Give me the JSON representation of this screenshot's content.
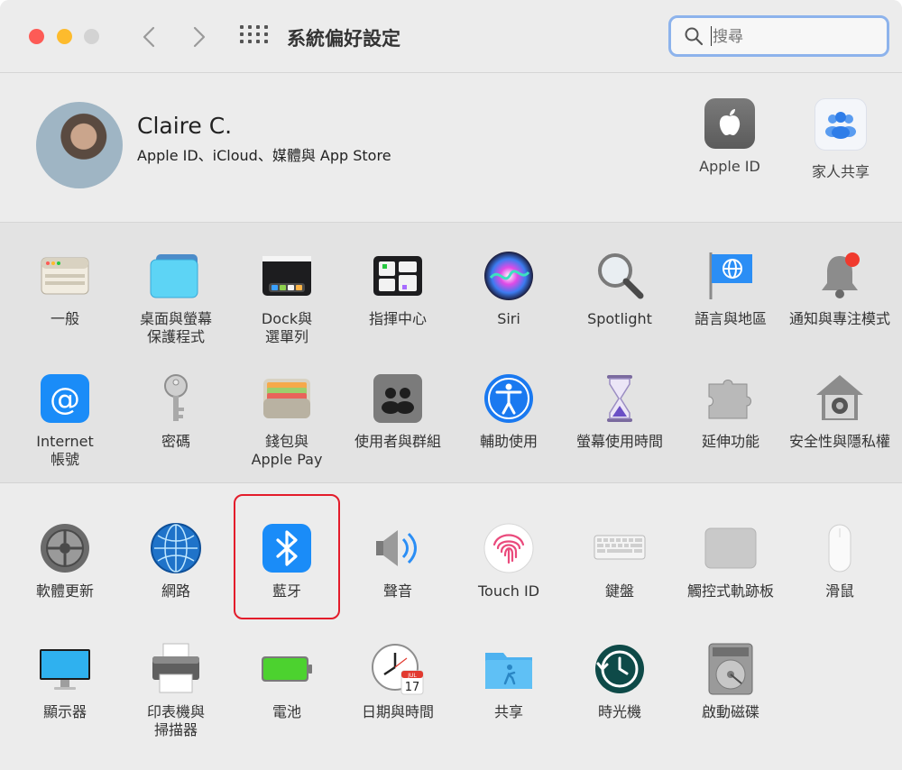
{
  "window": {
    "title": "系統偏好設定"
  },
  "search": {
    "placeholder": "搜尋",
    "value": ""
  },
  "account": {
    "name": "Claire C.",
    "subtitle": "Apple ID、iCloud、媒體與 App Store",
    "items": [
      {
        "label": "Apple ID",
        "icon": "apple-logo-icon"
      },
      {
        "label": "家人共享",
        "icon": "family-sharing-icon"
      }
    ]
  },
  "panes_row1": [
    {
      "label": "一般",
      "icon": "general-icon"
    },
    {
      "label": "桌面與螢幕\n保護程式",
      "icon": "desktop-screensaver-icon"
    },
    {
      "label": "Dock與\n選單列",
      "icon": "dock-menubar-icon"
    },
    {
      "label": "指揮中心",
      "icon": "mission-control-icon"
    },
    {
      "label": "Siri",
      "icon": "siri-icon"
    },
    {
      "label": "Spotlight",
      "icon": "spotlight-icon"
    },
    {
      "label": "語言與地區",
      "icon": "language-region-icon"
    },
    {
      "label": "通知與專注模式",
      "icon": "notifications-icon"
    }
  ],
  "panes_row2": [
    {
      "label": "Internet\n帳號",
      "icon": "internet-accounts-icon"
    },
    {
      "label": "密碼",
      "icon": "passwords-key-icon"
    },
    {
      "label": "錢包與\nApple Pay",
      "icon": "wallet-icon"
    },
    {
      "label": "使用者與群組",
      "icon": "users-groups-icon"
    },
    {
      "label": "輔助使用",
      "icon": "accessibility-icon"
    },
    {
      "label": "螢幕使用時間",
      "icon": "screen-time-icon"
    },
    {
      "label": "延伸功能",
      "icon": "extensions-icon"
    },
    {
      "label": "安全性與隱私權",
      "icon": "security-privacy-icon"
    }
  ],
  "panes_row3": [
    {
      "label": "軟體更新",
      "icon": "software-update-icon"
    },
    {
      "label": "網路",
      "icon": "network-icon"
    },
    {
      "label": "藍牙",
      "icon": "bluetooth-icon"
    },
    {
      "label": "聲音",
      "icon": "sound-icon"
    },
    {
      "label": "Touch ID",
      "icon": "touch-id-icon"
    },
    {
      "label": "鍵盤",
      "icon": "keyboard-icon"
    },
    {
      "label": "觸控式軌跡板",
      "icon": "trackpad-icon"
    },
    {
      "label": "滑鼠",
      "icon": "mouse-icon"
    }
  ],
  "panes_row4": [
    {
      "label": "顯示器",
      "icon": "displays-icon"
    },
    {
      "label": "印表機與\n掃描器",
      "icon": "printers-scanners-icon"
    },
    {
      "label": "電池",
      "icon": "battery-icon"
    },
    {
      "label": "日期與時間",
      "icon": "date-time-icon"
    },
    {
      "label": "共享",
      "icon": "sharing-icon"
    },
    {
      "label": "時光機",
      "icon": "time-machine-icon"
    },
    {
      "label": "啟動磁碟",
      "icon": "startup-disk-icon"
    }
  ],
  "date_icon": {
    "month": "JUL",
    "day": "17"
  },
  "highlighted_pane": "藍牙",
  "colors": {
    "highlight": "#e31c2b",
    "search_focus": "#8db3ec",
    "accent_blue": "#1a8cf8"
  }
}
